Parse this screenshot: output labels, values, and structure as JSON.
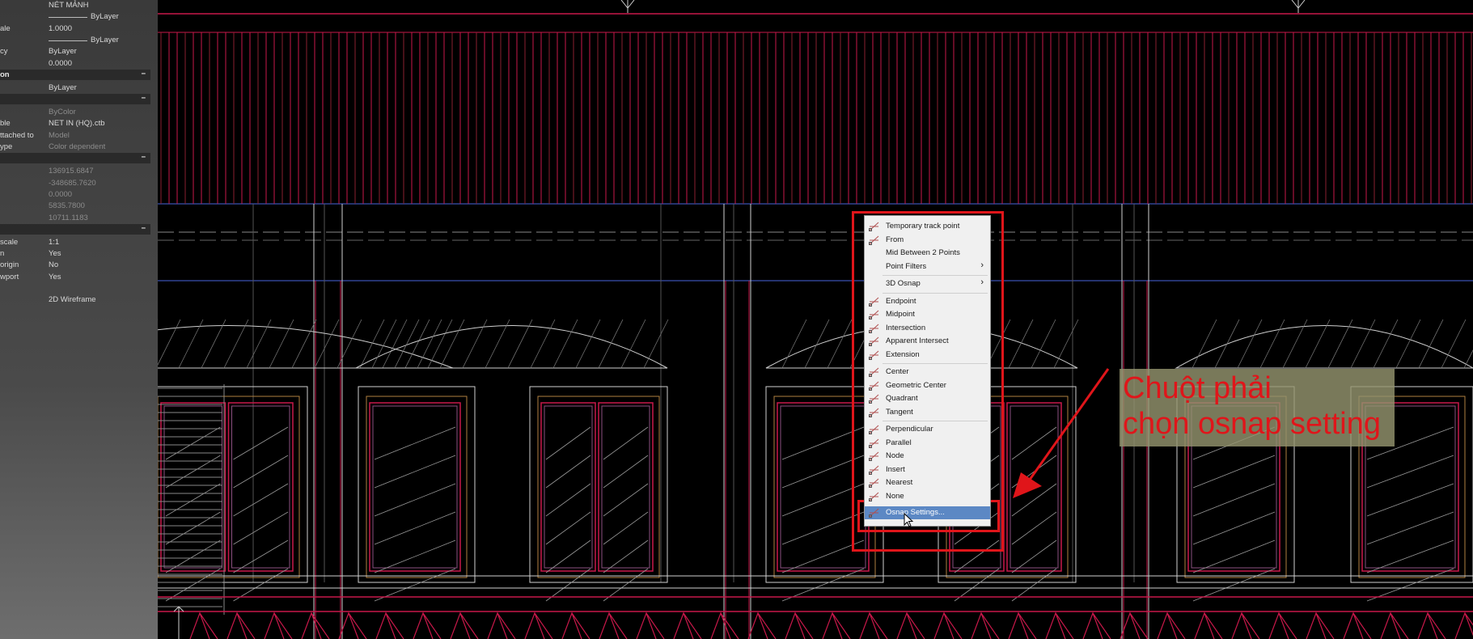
{
  "properties_panel": {
    "rows": [
      {
        "key": "",
        "value": "NÉT MẢNH",
        "kind": "text"
      },
      {
        "key": "",
        "value": "ByLayer",
        "kind": "byline"
      },
      {
        "key": "ale",
        "value": "1.0000",
        "kind": "text"
      },
      {
        "key": "",
        "value": "ByLayer",
        "kind": "byline"
      },
      {
        "key": "cy",
        "value": "ByLayer",
        "kind": "text"
      },
      {
        "key": "",
        "value": "0.0000",
        "kind": "text"
      },
      {
        "key": "on",
        "value": "",
        "kind": "section"
      },
      {
        "key": "",
        "value": "ByLayer",
        "kind": "text"
      },
      {
        "key": "",
        "value": "",
        "kind": "section"
      },
      {
        "key": "",
        "value": "ByColor",
        "kind": "dim"
      },
      {
        "key": "ble",
        "value": "NET IN (HQ).ctb",
        "kind": "text"
      },
      {
        "key": "ttached to",
        "value": "Model",
        "kind": "dim"
      },
      {
        "key": "ype",
        "value": "Color dependent",
        "kind": "dim"
      },
      {
        "key": "",
        "value": "",
        "kind": "section"
      },
      {
        "key": "",
        "value": "136915.6847",
        "kind": "dim"
      },
      {
        "key": "",
        "value": "-348685.7620",
        "kind": "dim"
      },
      {
        "key": "",
        "value": "0.0000",
        "kind": "dim"
      },
      {
        "key": "",
        "value": "5835.7800",
        "kind": "dim"
      },
      {
        "key": "",
        "value": "10711.1183",
        "kind": "dim"
      },
      {
        "key": "",
        "value": "",
        "kind": "section"
      },
      {
        "key": "scale",
        "value": "1:1",
        "kind": "text"
      },
      {
        "key": "n",
        "value": "Yes",
        "kind": "text"
      },
      {
        "key": "origin",
        "value": "No",
        "kind": "text"
      },
      {
        "key": "wport",
        "value": "Yes",
        "kind": "text"
      },
      {
        "key": "",
        "value": "",
        "kind": "blank"
      },
      {
        "key": "",
        "value": "2D Wireframe",
        "kind": "text"
      }
    ],
    "section_marker": "−"
  },
  "context_menu": {
    "items": [
      {
        "label": "Temporary track point",
        "icon": "track-point-icon"
      },
      {
        "label": "From",
        "icon": "from-icon"
      },
      {
        "label": "Mid Between 2 Points",
        "icon": ""
      },
      {
        "label": "Point Filters",
        "icon": "",
        "submenu": true
      },
      {
        "label": "3D Osnap",
        "icon": "",
        "submenu": true
      },
      {
        "label": "Endpoint",
        "icon": "endpoint-icon"
      },
      {
        "label": "Midpoint",
        "icon": "midpoint-icon"
      },
      {
        "label": "Intersection",
        "icon": "intersection-icon"
      },
      {
        "label": "Apparent Intersect",
        "icon": "apparent-intersect-icon"
      },
      {
        "label": "Extension",
        "icon": "extension-icon"
      },
      {
        "label": "Center",
        "icon": "center-icon"
      },
      {
        "label": "Geometric Center",
        "icon": "geometric-center-icon"
      },
      {
        "label": "Quadrant",
        "icon": "quadrant-icon"
      },
      {
        "label": "Tangent",
        "icon": "tangent-icon"
      },
      {
        "label": "Perpendicular",
        "icon": "perpendicular-icon"
      },
      {
        "label": "Parallel",
        "icon": "parallel-icon"
      },
      {
        "label": "Node",
        "icon": "node-icon"
      },
      {
        "label": "Insert",
        "icon": "insert-icon"
      },
      {
        "label": "Nearest",
        "icon": "nearest-icon"
      },
      {
        "label": "None",
        "icon": "none-icon"
      },
      {
        "label": "Osnap Settings...",
        "icon": "osnap-settings-icon",
        "selected": true
      }
    ],
    "submenu_arrow": "›"
  },
  "callout": {
    "line1": "Chuột phải",
    "line2": "chọn osnap setting"
  },
  "colors": {
    "annotation_red": "#e0151a",
    "highlight_blue": "#5c88c4",
    "drawing_red": "#c8184a",
    "drawing_white": "#d0d0d0"
  }
}
